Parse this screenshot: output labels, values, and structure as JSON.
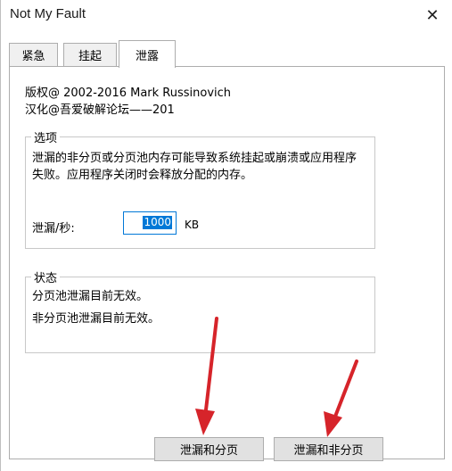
{
  "window": {
    "title": "Not My Fault"
  },
  "tabs": [
    {
      "label": "紧急",
      "active": false
    },
    {
      "label": "挂起",
      "active": false
    },
    {
      "label": "泄露",
      "active": true
    }
  ],
  "copyright": {
    "line1": "版权@ 2002-2016 Mark Russinovich",
    "line2": "汉化@吾爱破解论坛——201"
  },
  "options": {
    "legend": "选项",
    "description": "泄漏的非分页或分页池内存可能导致系统挂起或崩溃或应用程序失败。应用程序关闭时会释放分配的内存。",
    "rate_label": "泄漏/秒:",
    "rate_value": "1000",
    "rate_unit": "KB"
  },
  "status": {
    "legend": "状态",
    "paged": "分页池泄漏目前无效。",
    "nonpaged": "非分页池泄漏目前无效。"
  },
  "buttons": {
    "leak_paged": "泄漏和分页",
    "leak_nonpaged": "泄漏和非分页"
  },
  "colors": {
    "accent": "#0078d7",
    "annotation_arrow": "#d6242a"
  }
}
